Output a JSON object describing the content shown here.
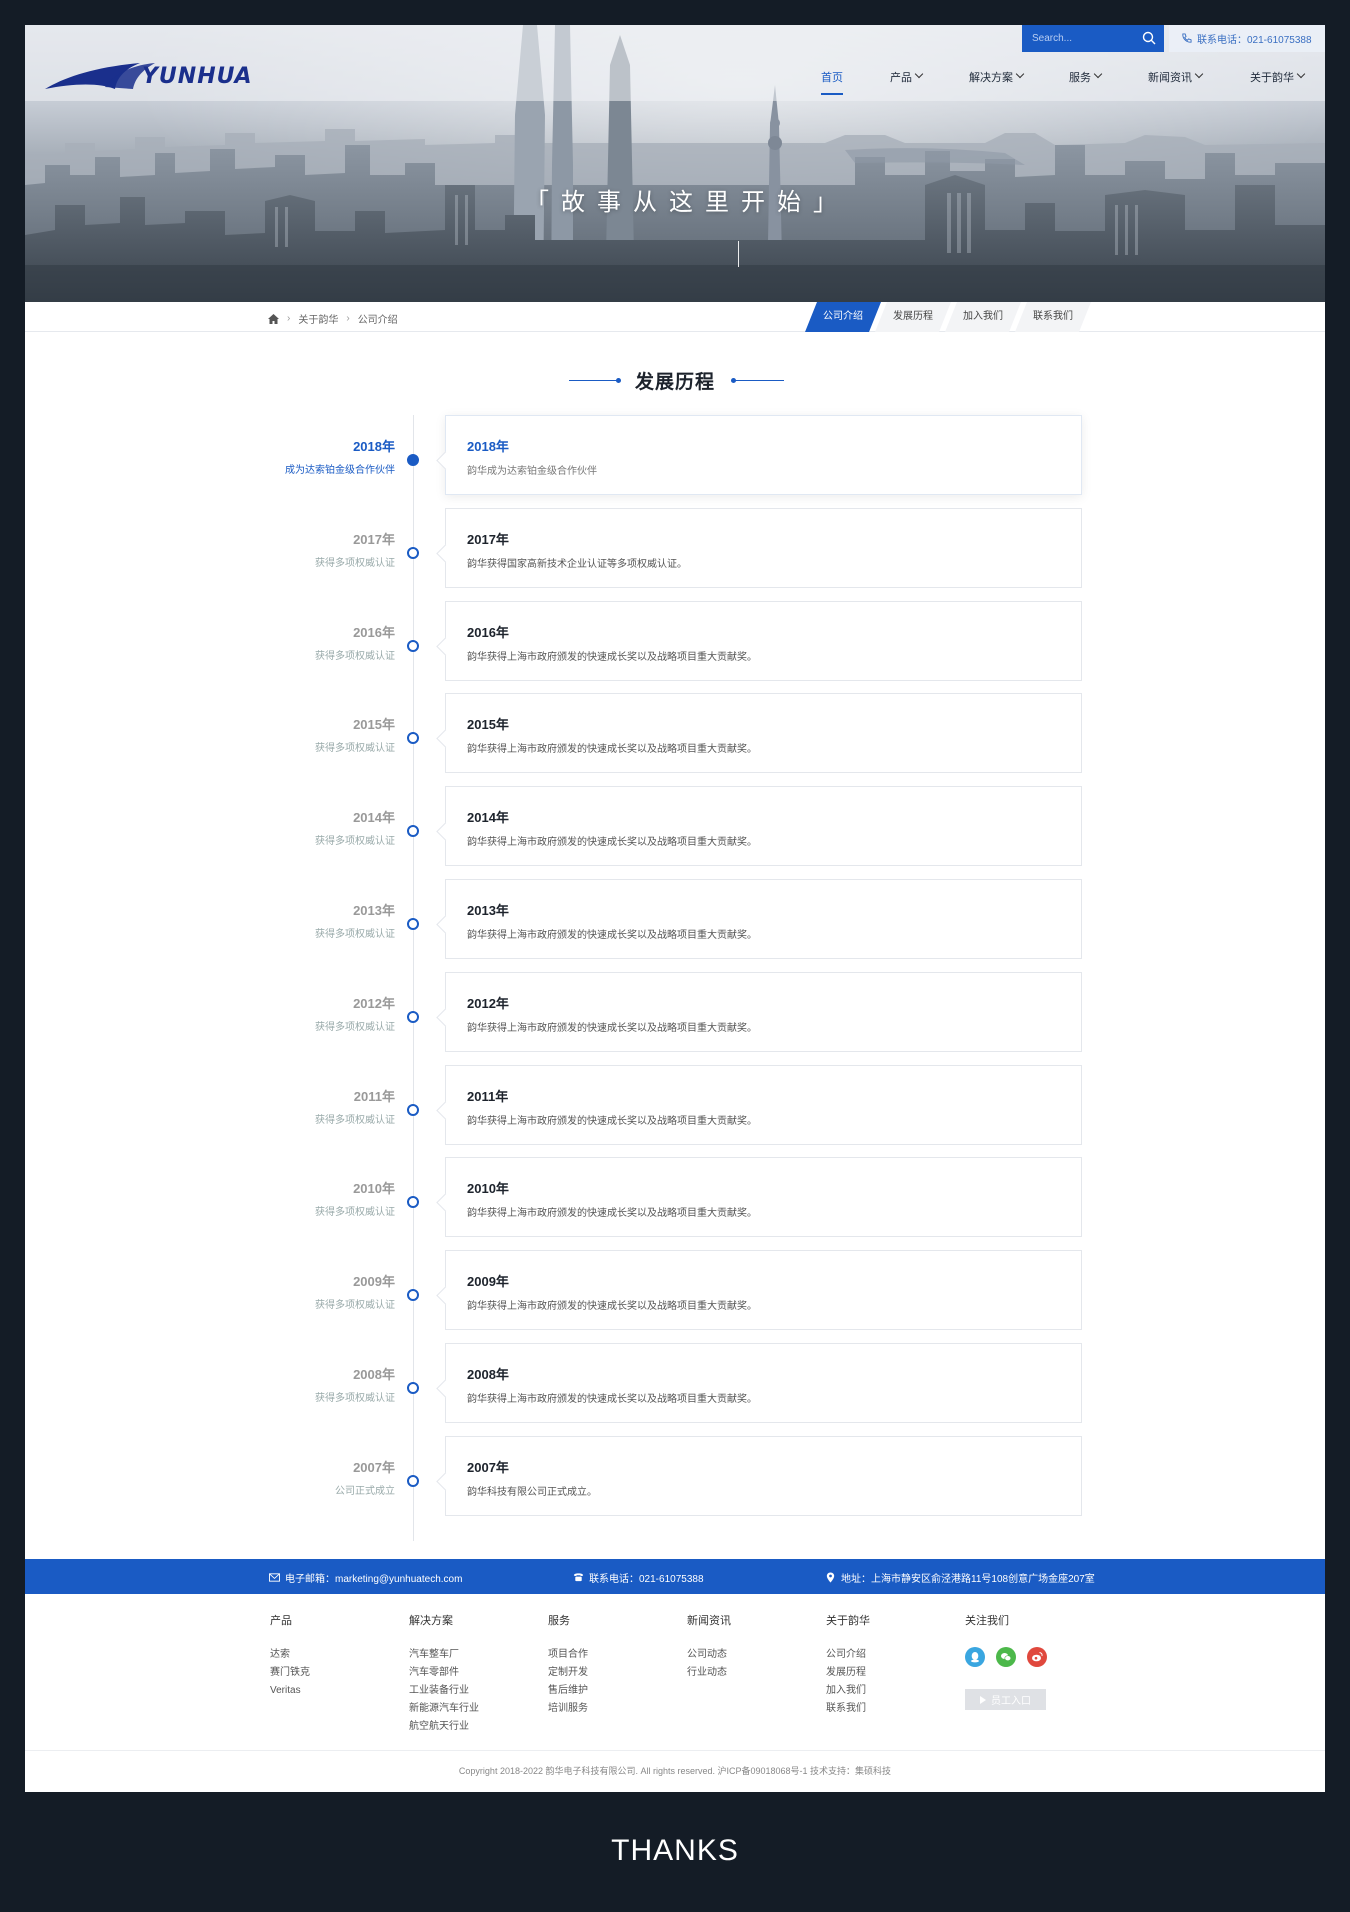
{
  "header": {
    "logo_text": "YUNHUA",
    "search_placeholder": "Search...",
    "phone_label": "联系电话：021-61075388",
    "nav": [
      {
        "label": "首页",
        "active": true
      },
      {
        "label": "产品",
        "dropdown": true
      },
      {
        "label": "解决方案",
        "dropdown": true
      },
      {
        "label": "服务",
        "dropdown": true
      },
      {
        "label": "新闻资讯",
        "dropdown": true
      },
      {
        "label": "关于韵华",
        "dropdown": true
      }
    ]
  },
  "hero": {
    "slogan": "「故事从这里开始」"
  },
  "breadcrumb": {
    "items": [
      "关于韵华",
      "公司介绍"
    ]
  },
  "tabs": [
    {
      "label": "公司介绍",
      "active": true
    },
    {
      "label": "发展历程"
    },
    {
      "label": "加入我们"
    },
    {
      "label": "联系我们"
    }
  ],
  "section_title": "发展历程",
  "timeline": [
    {
      "year": "2018年",
      "left_desc": "成为达索铂金级合作伙伴",
      "card_text": "韵华成为达索铂金级合作伙伴",
      "active": true
    },
    {
      "year": "2017年",
      "left_desc": "获得多项权威认证",
      "card_text": "韵华获得国家高新技术企业认证等多项权威认证。"
    },
    {
      "year": "2016年",
      "left_desc": "获得多项权威认证",
      "card_text": "韵华获得上海市政府颁发的快速成长奖以及战略项目重大贡献奖。"
    },
    {
      "year": "2015年",
      "left_desc": "获得多项权威认证",
      "card_text": "韵华获得上海市政府颁发的快速成长奖以及战略项目重大贡献奖。"
    },
    {
      "year": "2014年",
      "left_desc": "获得多项权威认证",
      "card_text": "韵华获得上海市政府颁发的快速成长奖以及战略项目重大贡献奖。"
    },
    {
      "year": "2013年",
      "left_desc": "获得多项权威认证",
      "card_text": "韵华获得上海市政府颁发的快速成长奖以及战略项目重大贡献奖。"
    },
    {
      "year": "2012年",
      "left_desc": "获得多项权威认证",
      "card_text": "韵华获得上海市政府颁发的快速成长奖以及战略项目重大贡献奖。"
    },
    {
      "year": "2011年",
      "left_desc": "获得多项权威认证",
      "card_text": "韵华获得上海市政府颁发的快速成长奖以及战略项目重大贡献奖。"
    },
    {
      "year": "2010年",
      "left_desc": "获得多项权威认证",
      "card_text": "韵华获得上海市政府颁发的快速成长奖以及战略项目重大贡献奖。"
    },
    {
      "year": "2009年",
      "left_desc": "获得多项权威认证",
      "card_text": "韵华获得上海市政府颁发的快速成长奖以及战略项目重大贡献奖。"
    },
    {
      "year": "2008年",
      "left_desc": "获得多项权威认证",
      "card_text": "韵华获得上海市政府颁发的快速成长奖以及战略项目重大贡献奖。"
    },
    {
      "year": "2007年",
      "left_desc": "公司正式成立",
      "card_text": "韵华科技有限公司正式成立。"
    }
  ],
  "contact": {
    "email": "电子邮箱：marketing@yunhuatech.com",
    "phone": "联系电话：021-61075388",
    "address": "地址：上海市静安区俞泾港路11号108创意广场金座207室"
  },
  "footer": {
    "columns": [
      {
        "title": "产品",
        "links": [
          "达索",
          "赛门铁克",
          "Veritas"
        ]
      },
      {
        "title": "解决方案",
        "links": [
          "汽车整车厂",
          "汽车零部件",
          "工业装备行业",
          "新能源汽车行业",
          "航空航天行业"
        ]
      },
      {
        "title": "服务",
        "links": [
          "项目合作",
          "定制开发",
          "售后维护",
          "培训服务"
        ]
      },
      {
        "title": "新闻资讯",
        "links": [
          "公司动态",
          "行业动态"
        ]
      },
      {
        "title": "关于韵华",
        "links": [
          "公司介绍",
          "发展历程",
          "加入我们",
          "联系我们"
        ]
      },
      {
        "title": "关注我们",
        "links": []
      }
    ],
    "social": [
      {
        "icon": "qq-icon",
        "color": "#3aa6e0"
      },
      {
        "icon": "wechat-icon",
        "color": "#4cb84a"
      },
      {
        "icon": "weibo-icon",
        "color": "#e0483d"
      }
    ],
    "staff_button": "员工入口",
    "copyright": "Copyright 2018-2022 韵华电子科技有限公司. All rights reserved. 沪ICP备09018068号-1   技术支持：集硕科技"
  },
  "thanks": "THANKS",
  "colors": {
    "accent": "#1a5bc4",
    "background": "#141c26"
  }
}
